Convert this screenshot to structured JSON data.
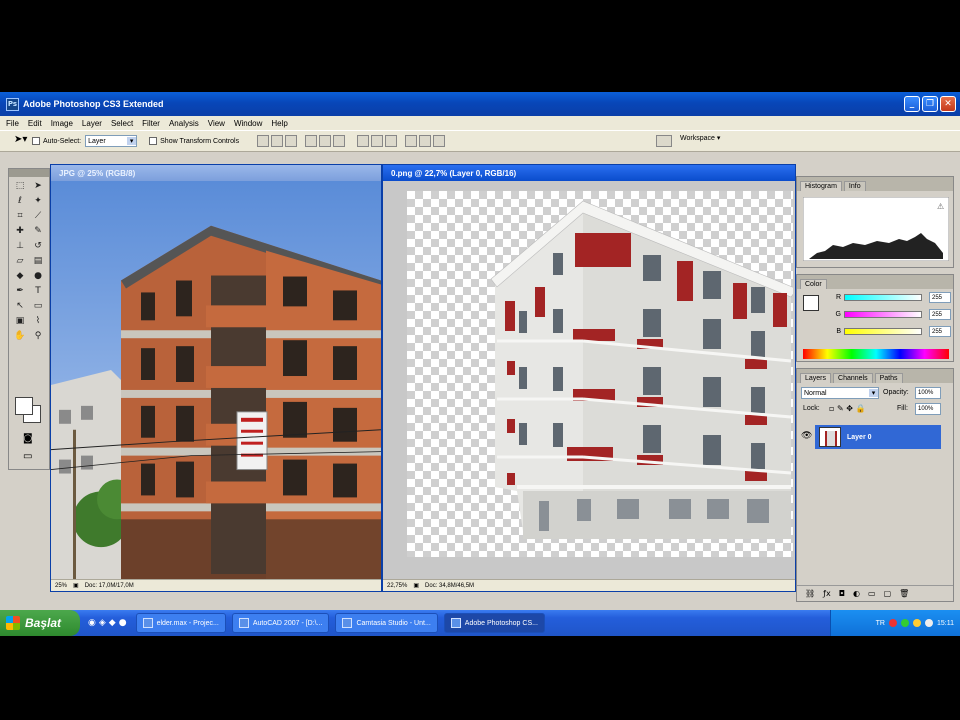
{
  "window": {
    "title": "Adobe Photoshop CS3 Extended",
    "app_badge": "Ps"
  },
  "menu": [
    "File",
    "Edit",
    "Image",
    "Layer",
    "Select",
    "Filter",
    "Analysis",
    "View",
    "Window",
    "Help"
  ],
  "options": {
    "auto_select_label": "Auto-Select:",
    "auto_select_value": "Layer",
    "show_transform_label": "Show Transform Controls",
    "workspace_label": "Workspace ▾"
  },
  "doc1": {
    "title": "JPG @ 25% (RGB/8)",
    "zoom": "25%",
    "doc_info": "Doc: 17,0M/17,0M"
  },
  "doc2": {
    "title": "0.png @ 22,7% (Layer 0, RGB/16)",
    "zoom": "22,75%",
    "doc_info": "Doc: 34,8M/46,5M"
  },
  "histogram": {
    "tabs": [
      "Histogram",
      "Info"
    ]
  },
  "color": {
    "tab": "Color",
    "channels": [
      {
        "name": "R",
        "value": "255"
      },
      {
        "name": "G",
        "value": "255"
      },
      {
        "name": "B",
        "value": "255"
      }
    ]
  },
  "layers": {
    "tabs": [
      "Layers",
      "Channels",
      "Paths"
    ],
    "blend_mode": "Normal",
    "opacity_label": "Opacity:",
    "opacity_value": "100%",
    "lock_label": "Lock:",
    "fill_label": "Fill:",
    "fill_value": "100%",
    "layer_name": "Layer 0"
  },
  "taskbar": {
    "start_label": "Başlat",
    "items": [
      {
        "label": "elder.max - Projec..."
      },
      {
        "label": "AutoCAD 2007 - [D:\\..."
      },
      {
        "label": "Camtasia Studio - Unt..."
      },
      {
        "label": "Adobe Photoshop CS..."
      }
    ],
    "lang": "TR",
    "clock": "15:11"
  },
  "colors": {
    "titlebar": "#0a4ccc",
    "layer_selected": "#3168d5",
    "brick": "#b9623a",
    "trim_red": "#a32424"
  }
}
